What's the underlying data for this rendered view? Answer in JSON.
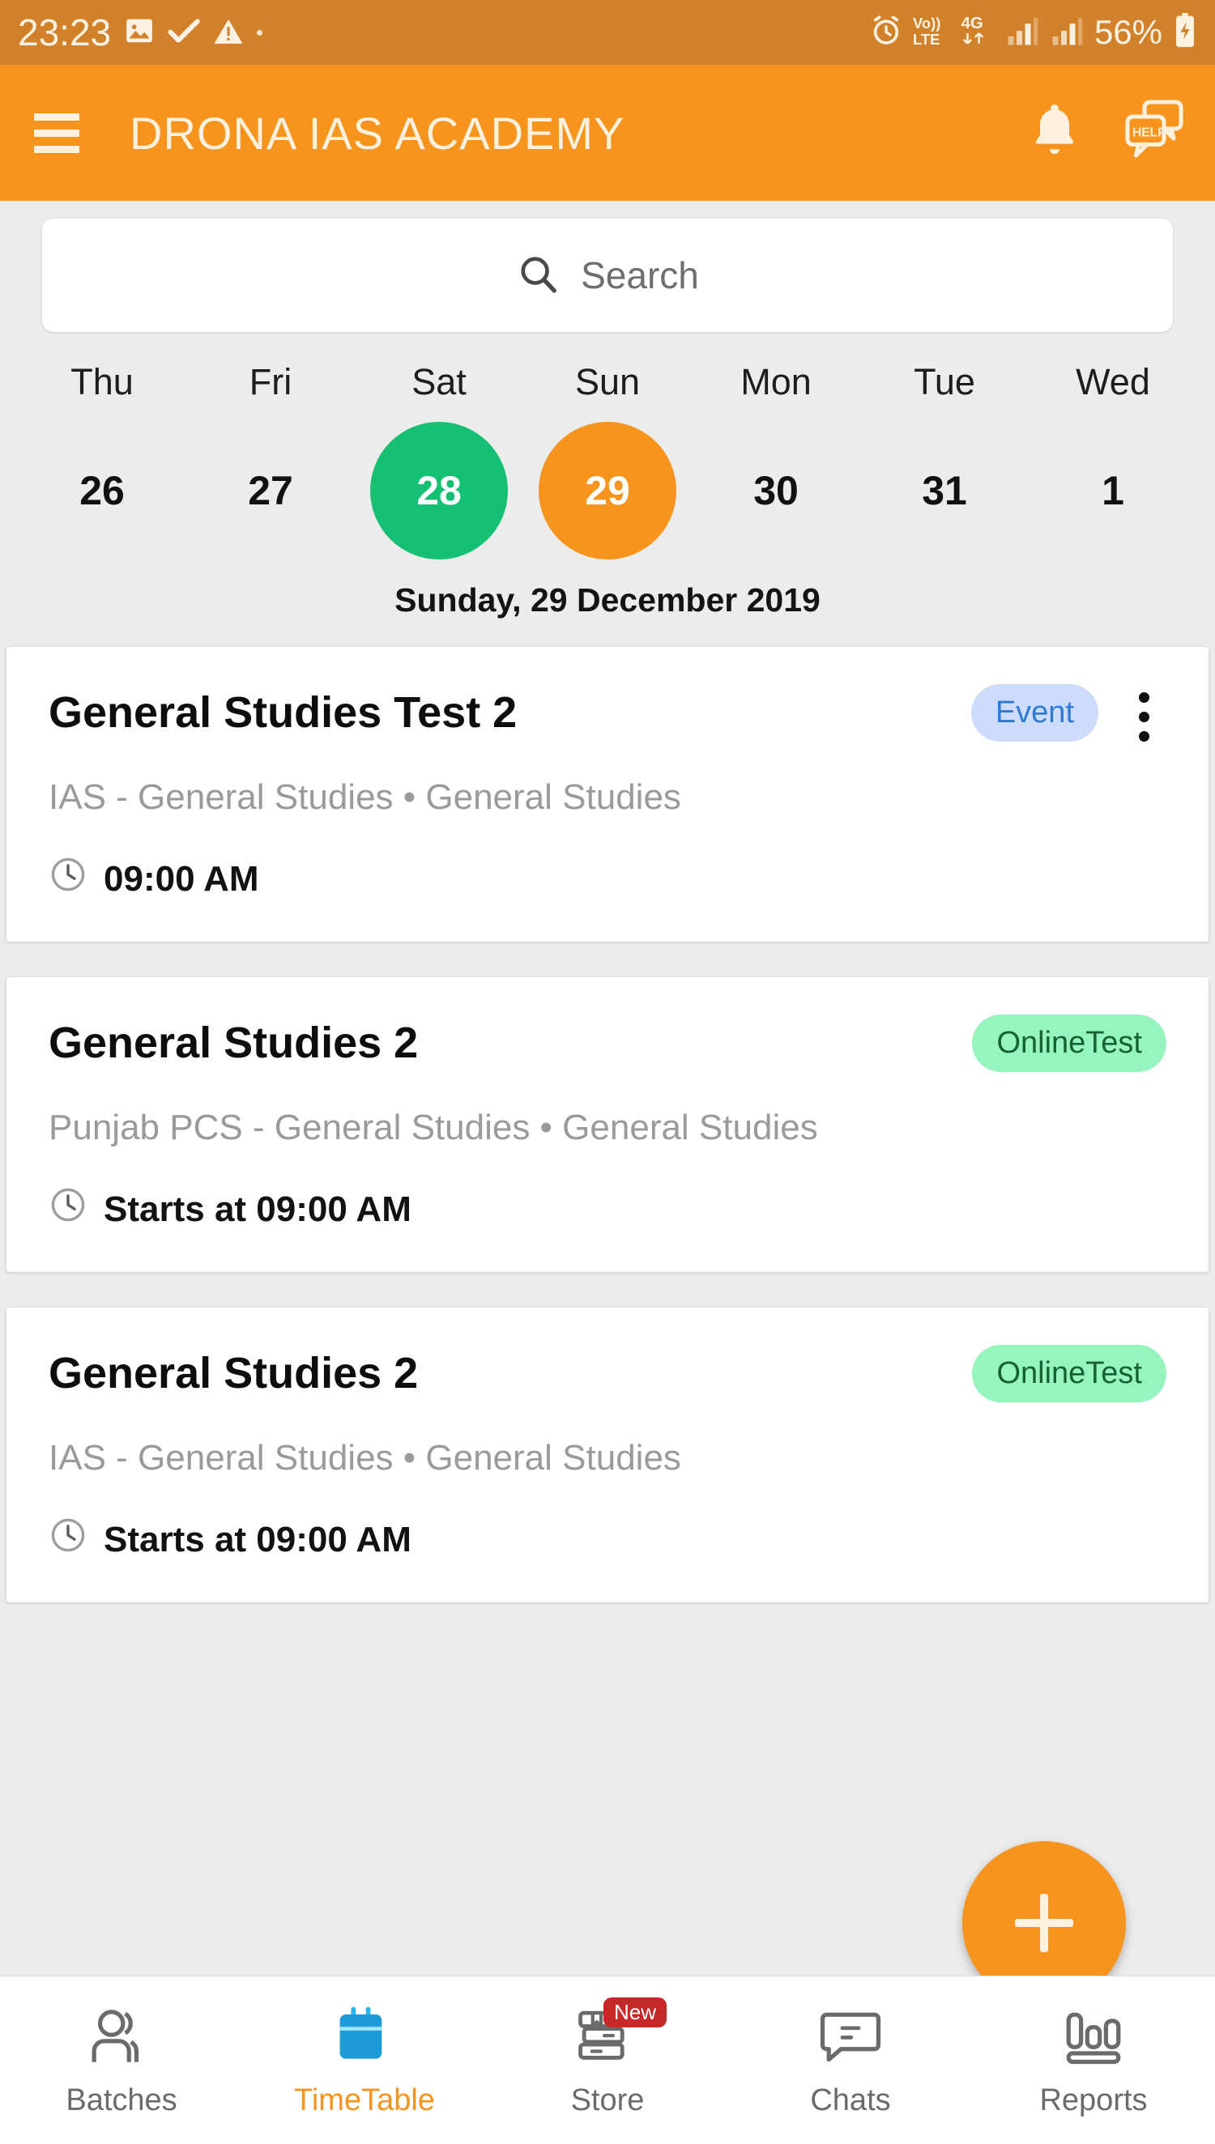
{
  "statusbar": {
    "time": "23:23",
    "battery_percent": "56%",
    "icons": [
      "image-icon",
      "checkmark-icon",
      "warning-icon",
      "dot-icon",
      "alarm-icon",
      "volte-icon",
      "4g-icon",
      "signal-bars-icon",
      "signal-bars-2-icon",
      "battery-icon"
    ]
  },
  "appbar": {
    "menu_icon": "hamburger-menu-icon",
    "title": "DRONA IAS ACADEMY",
    "notification_icon": "bell-icon",
    "help_icon": "help-chat-icon",
    "help_label": "HELP",
    "background": "#f6941d"
  },
  "search": {
    "placeholder": "Search",
    "icon": "search-icon"
  },
  "week": {
    "days": [
      {
        "name": "Thu",
        "num": "26",
        "state": "normal"
      },
      {
        "name": "Fri",
        "num": "27",
        "state": "normal"
      },
      {
        "name": "Sat",
        "num": "28",
        "state": "today"
      },
      {
        "name": "Sun",
        "num": "29",
        "state": "selected"
      },
      {
        "name": "Mon",
        "num": "30",
        "state": "normal"
      },
      {
        "name": "Tue",
        "num": "31",
        "state": "normal"
      },
      {
        "name": "Wed",
        "num": "1",
        "state": "normal"
      }
    ],
    "today_color": "#16c073",
    "selected_color": "#f6941d",
    "selected_date_label": "Sunday, 29 December 2019"
  },
  "cards": [
    {
      "title": "General Studies Test 2",
      "badge": "Event",
      "badge_type": "event",
      "badge_bg": "#ccdcfa",
      "badge_color": "#2f7bd4",
      "subtitle": "IAS - General Studies • General Studies",
      "time": "09:00 AM",
      "clock_icon": "clock-icon",
      "has_menu": true,
      "menu_icon": "kebab-menu-icon"
    },
    {
      "title": "General Studies 2",
      "badge": "OnlineTest",
      "badge_type": "onlinetest",
      "badge_bg": "#96f5bd",
      "badge_color": "#15612f",
      "subtitle": "Punjab PCS - General Studies • General Studies",
      "time": "Starts at 09:00 AM",
      "clock_icon": "clock-icon",
      "has_menu": false
    },
    {
      "title": "General Studies 2",
      "badge": "OnlineTest",
      "badge_type": "onlinetest",
      "badge_bg": "#96f5bd",
      "badge_color": "#15612f",
      "subtitle": "IAS - General Studies • General Studies",
      "time": "Starts at 09:00 AM",
      "clock_icon": "clock-icon",
      "has_menu": false
    }
  ],
  "fab": {
    "icon": "plus-icon",
    "color": "#f6941d"
  },
  "bottomnav": {
    "items": [
      {
        "label": "Batches",
        "icon": "people-icon",
        "active": false,
        "badge": ""
      },
      {
        "label": "TimeTable",
        "icon": "calendar-icon",
        "active": true,
        "badge": ""
      },
      {
        "label": "Store",
        "icon": "books-icon",
        "active": false,
        "badge": "New"
      },
      {
        "label": "Chats",
        "icon": "chat-bubble-icon",
        "active": false,
        "badge": ""
      },
      {
        "label": "Reports",
        "icon": "bar-chart-icon",
        "active": false,
        "badge": ""
      }
    ],
    "active_color": "#f6941d"
  }
}
